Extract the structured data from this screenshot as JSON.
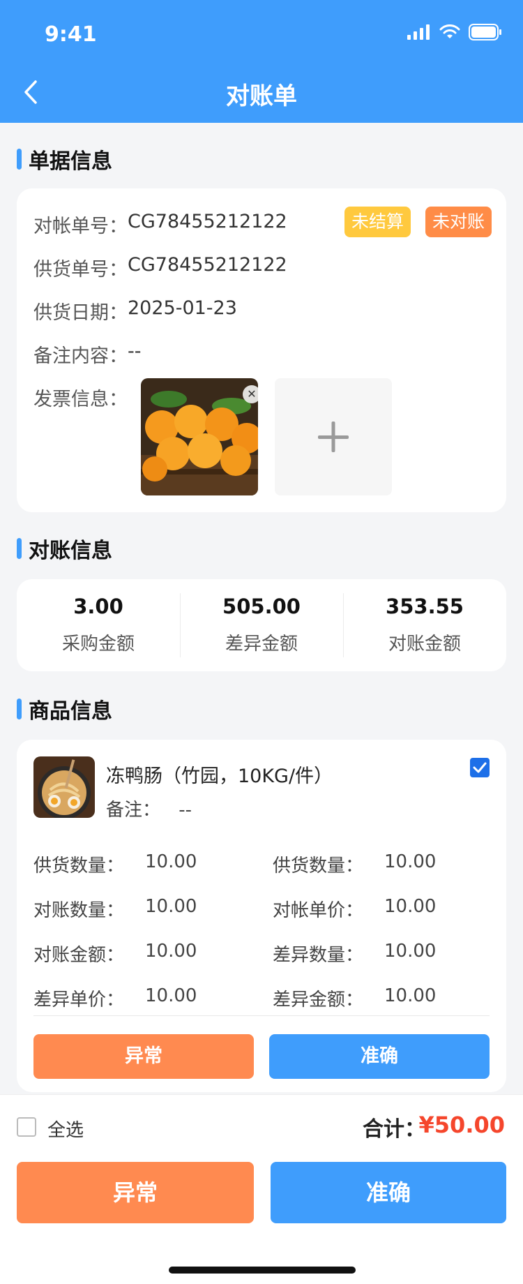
{
  "status_bar": {
    "time": "9:41"
  },
  "header": {
    "title": "对账单"
  },
  "doc_section": {
    "title": "单据信息",
    "reconcile_no_label": "对帐单号：",
    "reconcile_no": "CG78455212122",
    "supply_no_label": "供货单号：",
    "supply_no": "CG78455212122",
    "supply_date_label": "供货日期：",
    "supply_date": "2025-01-23",
    "remark_label": "备注内容：",
    "remark": "--",
    "invoice_label": "发票信息：",
    "badge_settle": "未结算",
    "badge_reconcile": "未对账"
  },
  "reconcile_section": {
    "title": "对账信息",
    "items": [
      {
        "value": "3.00",
        "label": "采购金额"
      },
      {
        "value": "505.00",
        "label": "差异金额"
      },
      {
        "value": "353.55",
        "label": "对账金额"
      }
    ]
  },
  "product_section": {
    "title": "商品信息",
    "product": {
      "name": "冻鸭肠（竹园，10KG/件）",
      "note_label": "备注：",
      "note": "--",
      "fields": [
        {
          "label": "供货数量：",
          "value": "10.00"
        },
        {
          "label": "供货数量：",
          "value": "10.00"
        },
        {
          "label": "对账数量：",
          "value": "10.00"
        },
        {
          "label": "对帐单价：",
          "value": "10.00"
        },
        {
          "label": "对账金额：",
          "value": "10.00"
        },
        {
          "label": "差异数量：",
          "value": "10.00"
        },
        {
          "label": "差异单价：",
          "value": "10.00"
        },
        {
          "label": "差异金额：",
          "value": "10.00"
        }
      ],
      "btn_abnormal": "异常",
      "btn_accurate": "准确"
    }
  },
  "bottom_bar": {
    "select_all": "全选",
    "total_label": "合计：",
    "total_value": "¥50.00",
    "btn_abnormal": "异常",
    "btn_accurate": "准确"
  },
  "colors": {
    "primary": "#3f9dfc",
    "orange": "#ff8a50",
    "yellow": "#ffc93e",
    "price_red": "#f5462c"
  }
}
